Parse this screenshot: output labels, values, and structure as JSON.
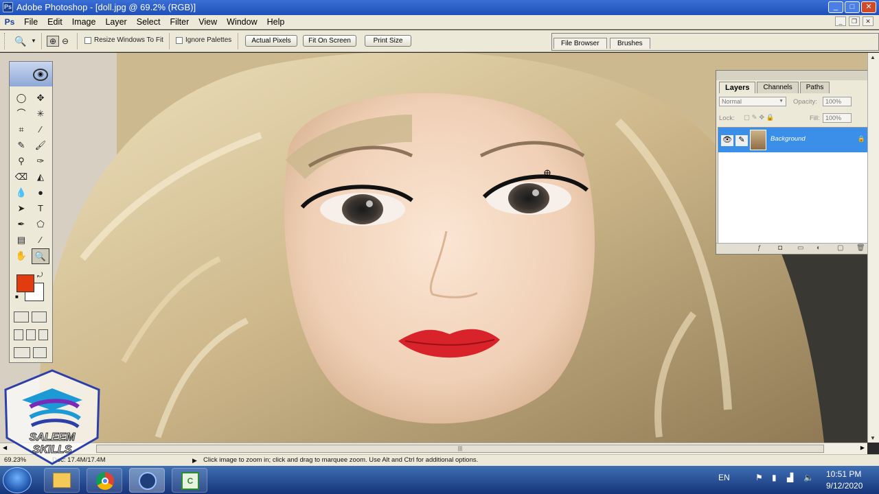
{
  "window": {
    "title": "Adobe Photoshop - [doll.jpg @ 69.2% (RGB)]",
    "min": "_",
    "max": "□",
    "close": "✕"
  },
  "menu": [
    "File",
    "Edit",
    "Image",
    "Layer",
    "Select",
    "Filter",
    "View",
    "Window",
    "Help"
  ],
  "options": {
    "resize_label": "Resize Windows To Fit",
    "ignore_label": "Ignore Palettes",
    "actual_pixels": "Actual Pixels",
    "fit_on_screen": "Fit On Screen",
    "print_size": "Print Size"
  },
  "well_tabs": [
    "File Browser",
    "Brushes"
  ],
  "layers_panel": {
    "tabs": [
      "Layers",
      "Channels",
      "Paths"
    ],
    "blend_mode": "Normal",
    "opacity_label": "Opacity:",
    "opacity": "100%",
    "lock_label": "Lock:",
    "fill_label": "Fill:",
    "fill": "100%",
    "layer_name": "Background"
  },
  "status": {
    "zoom": "69.23%",
    "doc": "Doc: 17.4M/17.4M",
    "hint": "Click image to zoom in; click and drag to marquee zoom.  Use Alt and Ctrl for additional options."
  },
  "logo_text": [
    "SALEEM",
    "SKILLS"
  ],
  "tray": {
    "lang": "EN",
    "time": "10:51 PM",
    "date": "9/12/2020"
  },
  "colors": {
    "foreground": "#e23b10",
    "background": "#ffffff",
    "selection": "#3b8fe8"
  }
}
